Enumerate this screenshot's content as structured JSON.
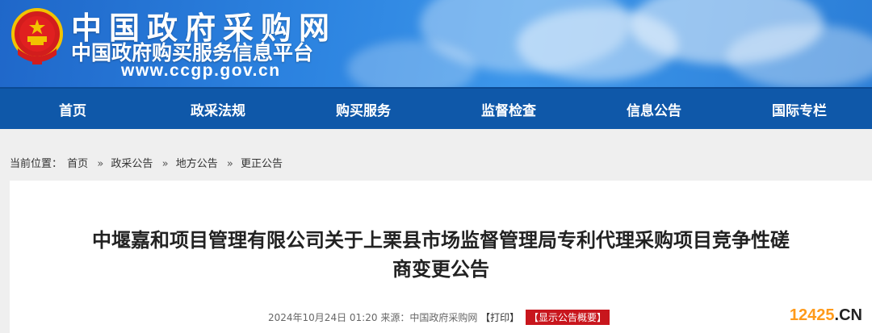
{
  "header": {
    "site_name": "中国政府采购网",
    "subtitle": "中国政府购买服务信息平台",
    "url": "www.ccgp.gov.cn"
  },
  "nav": {
    "items": [
      {
        "label": "首页"
      },
      {
        "label": "政采法规"
      },
      {
        "label": "购买服务"
      },
      {
        "label": "监督检查"
      },
      {
        "label": "信息公告"
      },
      {
        "label": "国际专栏"
      }
    ]
  },
  "breadcrumb": {
    "prefix": "当前位置：",
    "items": [
      "首页",
      "政采公告",
      "地方公告",
      "更正公告"
    ],
    "separator": "»"
  },
  "article": {
    "title_line1": "中堰嘉和项目管理有限公司关于上栗县市场监督管理局专利代理采购项目竞争性磋",
    "title_line2": "商变更公告",
    "datetime": "2024年10月24日 01:20",
    "source_label": "来源：",
    "source": "中国政府采购网",
    "print": "【打印】",
    "summary": "【显示公告概要】"
  },
  "watermark": {
    "number": "12425",
    "dot": ".",
    "suffix": "CN"
  },
  "colors": {
    "nav_bg": "#0f58a9",
    "header_bg": "#2c83e0",
    "summary_bg": "#c8161d",
    "watermark": "#ff9a1a"
  }
}
